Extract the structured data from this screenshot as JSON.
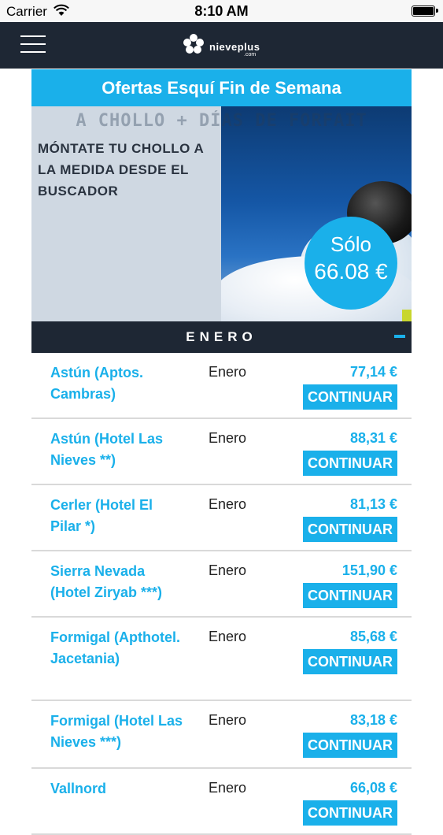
{
  "status": {
    "carrier": "Carrier",
    "time": "8:10 AM"
  },
  "nav": {
    "logo_text": "nieveplus",
    "logo_sub": ".com"
  },
  "page": {
    "title": "Ofertas Esquí Fin de Semana"
  },
  "banner": {
    "top_text": "A CHOLLO + DÍAS DE FORFAIT",
    "text": "MÓNTATE TU CHOLLO A LA MEDIDA DESDE EL BUSCADOR",
    "badge_label": "Sólo",
    "badge_value": "66.08 €"
  },
  "month_section": {
    "label": "ENERO",
    "collapse_symbol": "−"
  },
  "offers": [
    {
      "name": "Astún (Aptos. Cambras)",
      "month": "Enero",
      "price": "77,14 €",
      "button": "CONTINUAR"
    },
    {
      "name": "Astún (Hotel Las Nieves **)",
      "month": "Enero",
      "price": "88,31 €",
      "button": "CONTINUAR"
    },
    {
      "name": "Cerler (Hotel El Pilar *)",
      "month": "Enero",
      "price": "81,13 €",
      "button": "CONTINUAR"
    },
    {
      "name": "Sierra Nevada (Hotel Ziryab ***)",
      "month": "Enero",
      "price": "151,90 €",
      "button": "CONTINUAR"
    },
    {
      "name": "Formigal (Apthotel. Jacetania)",
      "month": "Enero",
      "price": "85,68 €",
      "button": "CONTINUAR"
    },
    {
      "name": "Formigal (Hotel Las Nieves ***)",
      "month": "Enero",
      "price": "83,18 €",
      "button": "CONTINUAR"
    },
    {
      "name": "Vallnord",
      "month": "Enero",
      "price": "66,08 €",
      "button": "CONTINUAR"
    }
  ],
  "colors": {
    "accent": "#1ab0ea",
    "navbar": "#1e2734"
  }
}
